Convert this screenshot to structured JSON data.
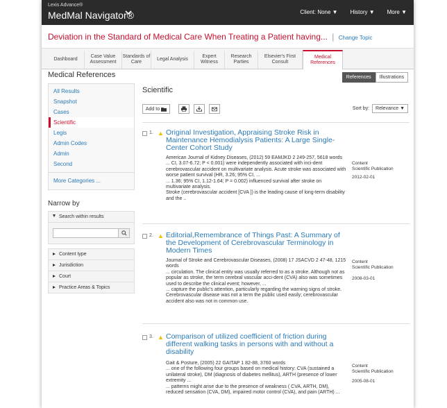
{
  "app": {
    "brand_small": "Lexis Advance®",
    "brand": "MedMal Navigator®",
    "top_nav": [
      "Client: None ▼",
      "History ▼",
      "More ▼"
    ]
  },
  "topic": {
    "title": "Deviation in the Standard of Medical Care When Treating a Patient having...",
    "separator": "|",
    "change_link": "Change Topic"
  },
  "tabs": [
    {
      "label": "Dashboard"
    },
    {
      "label": "Case Value Assessment"
    },
    {
      "label": "Standards of Care"
    },
    {
      "label": "Legal Analysis"
    },
    {
      "label": "Expert Witness"
    },
    {
      "label": "Research Parties"
    },
    {
      "label": "Elsevier's First Consult"
    },
    {
      "label": "Medical References",
      "active": true
    }
  ],
  "sidebar": {
    "title": "Medical References",
    "categories": [
      "All Results",
      "Snapshot",
      "Cases",
      "Scientific",
      "Legis",
      "Admin Codes",
      "Admin",
      "Second"
    ],
    "active": "Scientific",
    "more": "More Categories ...",
    "narrow_title": "Narrow by",
    "search_within": "Search within results",
    "search_value": "",
    "filters": [
      "Content type",
      "Jurisdiction",
      "Court",
      "Practice Areas & Topics"
    ]
  },
  "main": {
    "toggle": [
      "References",
      "Illustrations"
    ],
    "section_title": "Scientific",
    "add_to": "Add to",
    "sort_label": "Sort by:",
    "sort_value": "Relevance ▼",
    "results": [
      {
        "num": "1.",
        "title": "Original Investigation, Appraising Stroke Risk in Maintenance Hemodialysis Patients: A Large Single-Center Cohort Study",
        "source": "American Journal of Kidney Diseases, (2012) 59 EAMJKD 2 249-257, 5618 words",
        "snippets": [
          "... CI, 3.07-6.72; P < 0.001) were independently associated with inci-dent cerebrovascular accident on multivariate analysis. Acute stroke was associated with worse patient survival (HR, 3.26; 95% CI, ...",
          "... 1.36; 95% CI, 1.12-1.64; P = 0.002) influenced survival after stroke on multivariate analysis.",
          "Stroke (cerebrovascular accident [CVA ]) is the leading cause of long-term disability and the .."
        ],
        "meta_label": "Content",
        "meta_type": "Scientific Publication",
        "date": "2012-02-01"
      },
      {
        "num": "2.",
        "title": "Editorial,Remembrance of Things Past: A Summary of the Development of Cerebrovascular Terminology in Modern Times",
        "source": "Journal of Stroke and Cerebrovascular Diseases, (2008) 17 JSACVD 2 47-48, 1215 words",
        "snippets": [
          "... circulation. The clinical entity was usually referred to as a stroke. Although not as popular as stroke, the term cerebral vascular acci-dent (CVA) also was sometimes used to describe the clinical event; however, ...",
          "... capture the public's attention, particularly regarding the warning signs of stroke. Cerebrovascular disease was not a term the public used easily; cerebrovascular accident also was not in common use."
        ],
        "meta_label": "Content",
        "meta_type": "Scientific Publication",
        "date": "2008-03-01"
      },
      {
        "num": "3.",
        "title": "Comparison of utilized coefficient of friction during different walking tasks in persons with and without a disability",
        "source": "Gait & Posture, (2005) 22 GAITAP 1 82-88, 3760 words",
        "snippets": [
          "... one of the following four groups based on medical history: CVA (sustained a unilateral stroke), DM (diagnosis of diabetes mellitus), ARTH (presence of lower extremity ...",
          "... patterns might arise due to the presence of weakness ( CVA, ARTH, DM), reduced sensation (CVA, DM), impaired motor control (CVA), and pain (ARTH) ..."
        ],
        "meta_label": "Content",
        "meta_type": "Scientific Publication",
        "date": "2005-08-01"
      }
    ]
  },
  "colors": {
    "accent": "#c8102e",
    "link": "#2a7ab8",
    "topbar": "#2b2b2b",
    "warning": "#f0c000"
  },
  "icons": [
    "chevron-down-icon",
    "folder-icon",
    "print-icon",
    "download-icon",
    "email-icon",
    "search-icon",
    "warning-icon"
  ]
}
